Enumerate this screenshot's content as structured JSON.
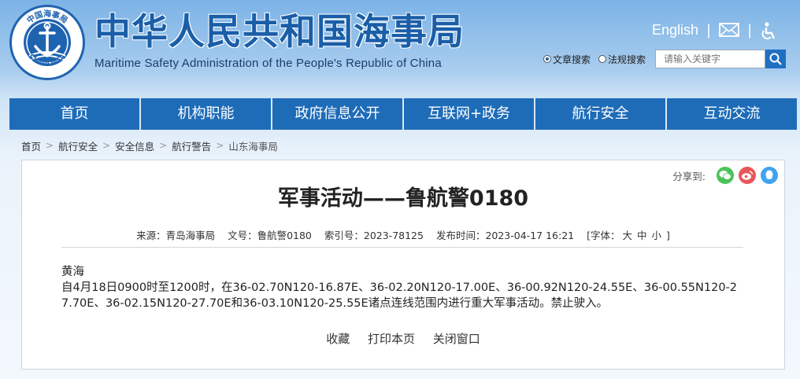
{
  "header": {
    "title": "中华人民共和国海事局",
    "subtitle": "Maritime Safety Administration of the People's Republic of China",
    "logo_text_top": "中国海事局",
    "logo_text_bottom": "CHINA MSA",
    "lang_link": "English",
    "separator": "|",
    "mail_icon": "mail-icon",
    "accessibility_icon": "accessibility-icon"
  },
  "search": {
    "option_article": "文章搜索",
    "option_regulation": "法规搜索",
    "selected": "文章搜索",
    "placeholder": "请输入关键字",
    "button_icon": "search-icon"
  },
  "nav": [
    {
      "label": "首页"
    },
    {
      "label": "机构职能"
    },
    {
      "label": "政府信息公开"
    },
    {
      "label": "互联网+政务"
    },
    {
      "label": "航行安全"
    },
    {
      "label": "互动交流"
    }
  ],
  "breadcrumb": [
    "首页",
    "航行安全",
    "安全信息",
    "航行警告",
    "山东海事局"
  ],
  "breadcrumb_sep": ">",
  "article": {
    "share_label": "分享到:",
    "share_icons": [
      "wechat-icon",
      "weibo-icon",
      "qq-icon"
    ],
    "title": "军事活动——鲁航警0180",
    "meta": {
      "source": "来源：青岛海事局",
      "doc_no": "文号：鲁航警0180",
      "index_no": "索引号：2023-78125",
      "publish_time": "发布时间：2023-04-17 16:21",
      "font_label": "[字体：",
      "font_large": "大",
      "font_medium": "中",
      "font_small": "小",
      "font_close": "]"
    },
    "region": "黄海",
    "body": "自4月18日0900时至1200时，在36-02.70N120-16.87E、36-02.20N120-17.00E、36-00.92N120-24.55E、36-00.55N120-27.70E、36-02.15N120-27.70E和36-03.10N120-25.55E诸点连线范围内进行重大军事活动。禁止驶入。",
    "actions": {
      "favorite": "收藏",
      "print": "打印本页",
      "close": "关闭窗口"
    }
  },
  "colors": {
    "brand_blue": "#1e6cb8",
    "title_blue": "#1a5ea8",
    "wechat_green": "#4cc35a",
    "weibo_red": "#e8565a",
    "qq_blue": "#3fa3ef"
  }
}
